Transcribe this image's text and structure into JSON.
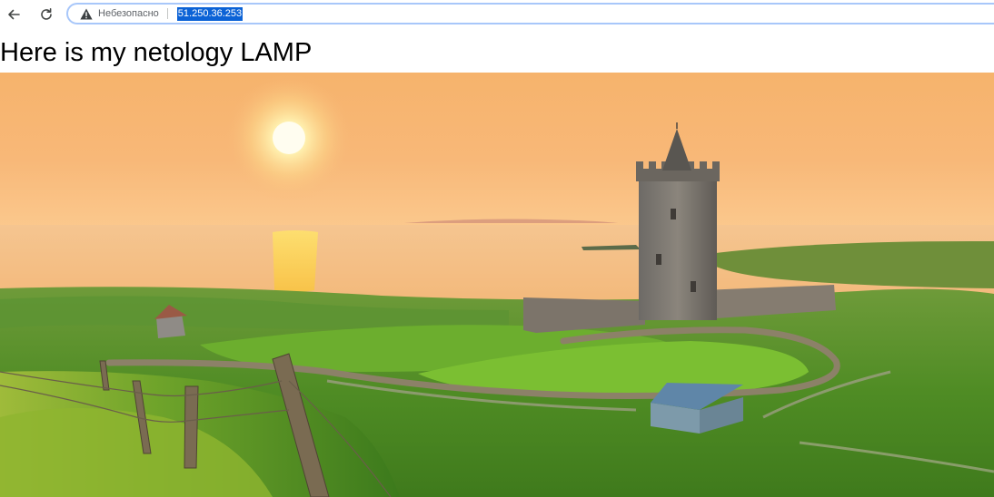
{
  "browser": {
    "back_icon": "arrow-left-icon",
    "reload_icon": "reload-icon",
    "security_icon": "warning-triangle-icon",
    "security_text": "Небезопасно",
    "url": "51.250.36.253",
    "colors": {
      "focus_ring": "#a8c7fa",
      "selection": "#0b62d6"
    }
  },
  "page": {
    "heading": "Here is my netology LAMP",
    "image": {
      "subject": "castle-tower-sunset-landscape",
      "colors": {
        "sky": "#f7b870",
        "sun": "#fff6c8",
        "grass": "#5a9a2c"
      }
    }
  }
}
